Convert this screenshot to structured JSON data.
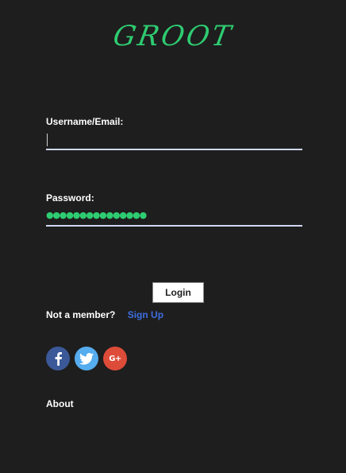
{
  "brand": {
    "logo_text": "GROOT",
    "color": "#2ecc71"
  },
  "login_form": {
    "username_label": "Username/Email:",
    "username_value": "",
    "password_label": "Password:",
    "password_mask": "●●●●●●●●●●●●●●●",
    "submit_label": "Login"
  },
  "signup": {
    "prompt": "Not a member?",
    "link_label": "Sign Up",
    "link_color": "#3d6ee0"
  },
  "social": [
    {
      "icon": "facebook-icon",
      "color": "#3b5998"
    },
    {
      "icon": "twitter-icon",
      "color": "#55acee"
    },
    {
      "icon": "google-plus-icon",
      "color": "#dd4b39",
      "glyph": "G+"
    }
  ],
  "footer": {
    "about_label": "About"
  },
  "theme": {
    "background": "#1e1e1e",
    "input_underline": "#d0d8f0"
  }
}
